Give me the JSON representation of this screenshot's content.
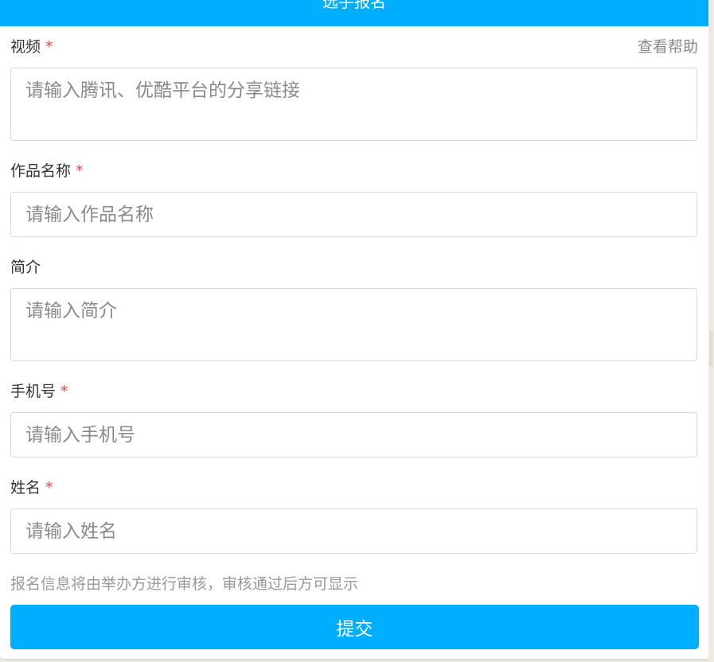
{
  "header": {
    "title": "选手报名"
  },
  "help_link": "查看帮助",
  "required_mark": "*",
  "fields": {
    "video": {
      "label": "视频",
      "placeholder": "请输入腾讯、优酷平台的分享链接",
      "value": ""
    },
    "title": {
      "label": "作品名称",
      "placeholder": "请输入作品名称",
      "value": ""
    },
    "intro": {
      "label": "简介",
      "placeholder": "请输入简介",
      "value": ""
    },
    "phone": {
      "label": "手机号",
      "placeholder": "请输入手机号",
      "value": ""
    },
    "name": {
      "label": "姓名",
      "placeholder": "请输入姓名",
      "value": ""
    }
  },
  "notice": "报名信息将由举办方进行审核，审核通过后方可显示",
  "submit_label": "提交",
  "colors": {
    "accent": "#00aeff",
    "required": "#e64545",
    "page_bg": "#efebe3"
  }
}
